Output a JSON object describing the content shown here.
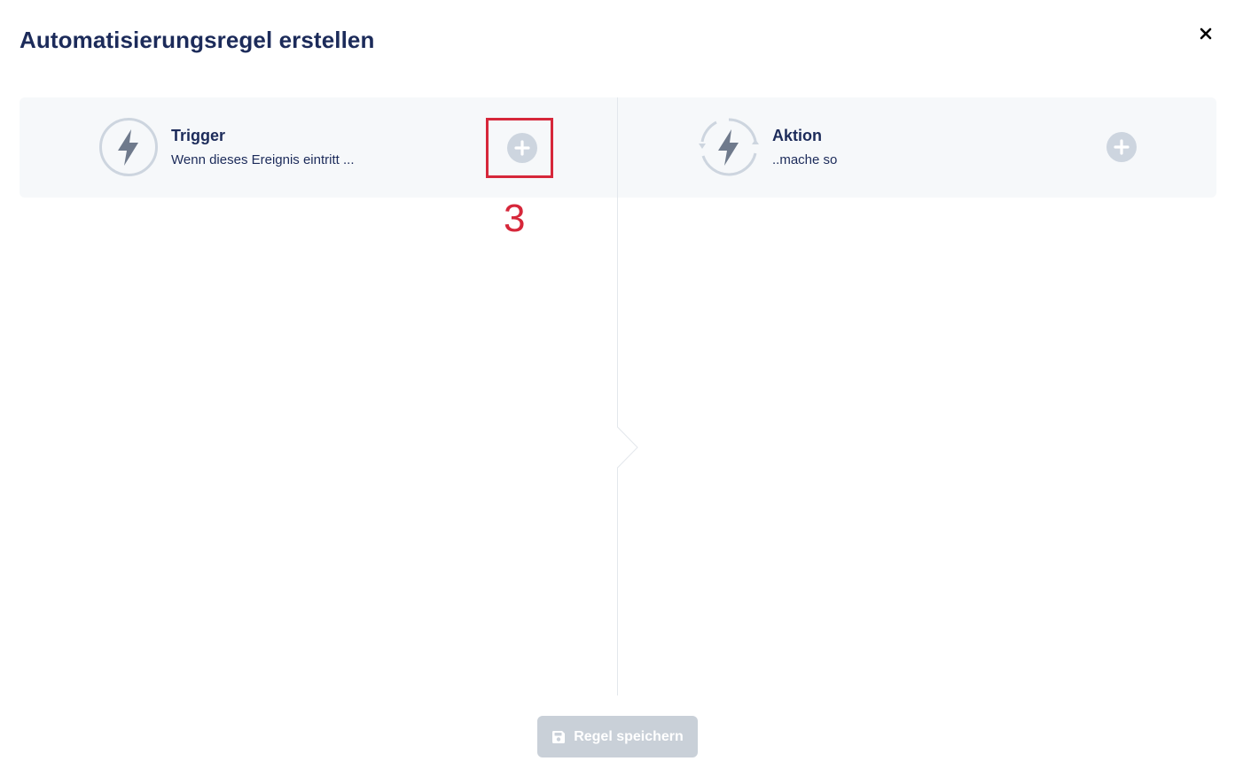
{
  "dialog": {
    "title": "Automatisierungsregel erstellen",
    "close_icon": "close-icon"
  },
  "trigger": {
    "icon": "lightning-icon",
    "title": "Trigger",
    "subtitle": "Wenn dieses Ereignis eintritt ...",
    "add_icon": "plus-circle-icon"
  },
  "action": {
    "icon": "lightning-cycle-icon",
    "title": "Aktion",
    "subtitle": "..mache so",
    "add_icon": "plus-circle-icon"
  },
  "annotation": {
    "label": "3",
    "color": "#d6273a"
  },
  "footer": {
    "save_label": "Regel speichern",
    "save_icon": "floppy-disk-icon",
    "save_disabled": true
  },
  "colors": {
    "title": "#1c2b5a",
    "panel_bg": "#f6f8fa",
    "icon_fill": "#6f7a8c",
    "icon_ring": "#cdd5df",
    "add_button": "#cdd5df",
    "save_button_disabled": "#c9d0d8"
  }
}
